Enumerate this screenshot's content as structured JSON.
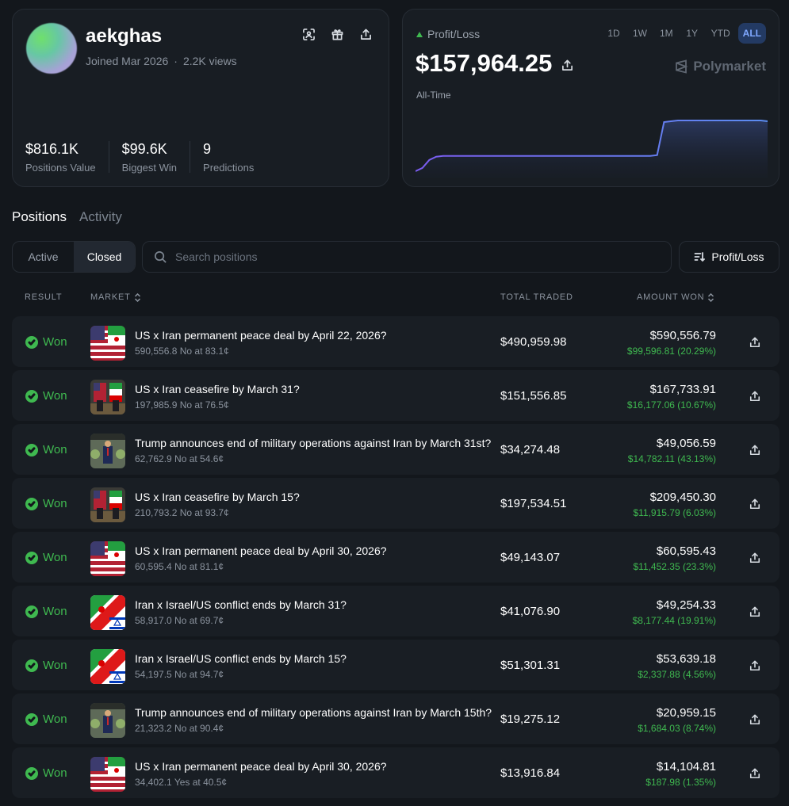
{
  "profile": {
    "username": "aekghas",
    "joined": "Joined Mar 2026",
    "views": "2.2K views",
    "icons": [
      "scan-icon",
      "gift-icon",
      "share-icon"
    ],
    "stats": [
      {
        "value": "$816.1K",
        "label": "Positions Value"
      },
      {
        "value": "$99.6K",
        "label": "Biggest Win"
      },
      {
        "value": "9",
        "label": "Predictions"
      }
    ]
  },
  "pnl": {
    "label": "Profit/Loss",
    "value": "$157,964.25",
    "range_label": "All-Time",
    "brand": "Polymarket",
    "timeframes": [
      "1D",
      "1W",
      "1M",
      "1Y",
      "YTD",
      "ALL"
    ],
    "active_timeframe": "ALL",
    "accent": "#5b6cf0"
  },
  "chart_data": {
    "type": "area",
    "points": [
      0,
      4,
      14,
      18,
      19,
      19,
      19,
      19,
      19,
      19,
      19,
      19,
      19,
      19,
      19,
      19,
      19,
      19,
      19,
      19,
      19,
      19,
      19,
      19,
      19,
      19,
      19,
      19,
      19,
      19,
      19,
      19,
      19,
      19,
      19,
      20,
      61,
      62,
      63,
      63,
      63,
      63,
      63,
      63,
      63,
      63,
      63,
      63,
      63,
      63,
      63,
      62
    ]
  },
  "tabs": [
    {
      "label": "Positions",
      "active": true
    },
    {
      "label": "Activity",
      "active": false
    }
  ],
  "filters": {
    "segments": [
      {
        "label": "Active",
        "active": false
      },
      {
        "label": "Closed",
        "active": true
      }
    ],
    "search_placeholder": "Search positions",
    "sort_label": "Profit/Loss"
  },
  "table": {
    "headers": {
      "result": "RESULT",
      "market": "MARKET",
      "total_traded": "TOTAL TRADED",
      "amount_won": "AMOUNT WON"
    },
    "rows": [
      {
        "result": "Won",
        "thumb": "us-iran-flags",
        "title": "US x Iran permanent peace deal by April 22, 2026?",
        "sub": "590,556.8 No at 83.1¢",
        "traded": "$490,959.98",
        "won": "$590,556.79",
        "won_pct": "$99,596.81 (20.29%)"
      },
      {
        "result": "Won",
        "thumb": "us-iran-diplomats",
        "title": "US x Iran ceasefire by March 31?",
        "sub": "197,985.9 No at 76.5¢",
        "traded": "$151,556.85",
        "won": "$167,733.91",
        "won_pct": "$16,177.06 (10.67%)"
      },
      {
        "result": "Won",
        "thumb": "trump-speech",
        "title": "Trump announces end of military operations against Iran by March 31st?",
        "sub": "62,762.9 No at 54.6¢",
        "traded": "$34,274.48",
        "won": "$49,056.59",
        "won_pct": "$14,782.11 (43.13%)"
      },
      {
        "result": "Won",
        "thumb": "us-iran-diplomats",
        "title": "US x Iran ceasefire by March 15?",
        "sub": "210,793.2 No at 93.7¢",
        "traded": "$197,534.51",
        "won": "$209,450.30",
        "won_pct": "$11,915.79 (6.03%)"
      },
      {
        "result": "Won",
        "thumb": "us-iran-flags",
        "title": "US x Iran permanent peace deal by April 30, 2026?",
        "sub": "60,595.4 No at 81.1¢",
        "traded": "$49,143.07",
        "won": "$60,595.43",
        "won_pct": "$11,452.35 (23.3%)"
      },
      {
        "result": "Won",
        "thumb": "iran-israel-flags",
        "title": "Iran x Israel/US conflict ends by March 31?",
        "sub": "58,917.0 No at 69.7¢",
        "traded": "$41,076.90",
        "won": "$49,254.33",
        "won_pct": "$8,177.44 (19.91%)"
      },
      {
        "result": "Won",
        "thumb": "iran-israel-flags",
        "title": "Iran x Israel/US conflict ends by March 15?",
        "sub": "54,197.5 No at 94.7¢",
        "traded": "$51,301.31",
        "won": "$53,639.18",
        "won_pct": "$2,337.88 (4.56%)"
      },
      {
        "result": "Won",
        "thumb": "trump-speech",
        "title": "Trump announces end of military operations against Iran by March 15th?",
        "sub": "21,323.2 No at 90.4¢",
        "traded": "$19,275.12",
        "won": "$20,959.15",
        "won_pct": "$1,684.03 (8.74%)"
      },
      {
        "result": "Won",
        "thumb": "us-iran-flags",
        "title": "US x Iran permanent peace deal by April 30, 2026?",
        "sub": "34,402.1 Yes at 40.5¢",
        "traded": "$13,916.84",
        "won": "$14,104.81",
        "won_pct": "$187.98 (1.35%)"
      }
    ]
  },
  "colors": {
    "background": "#13171c",
    "card": "#181d23",
    "won_green": "#3fb950",
    "active_tab_bg": "#233a63",
    "active_tab_text": "#7fa8ff"
  }
}
